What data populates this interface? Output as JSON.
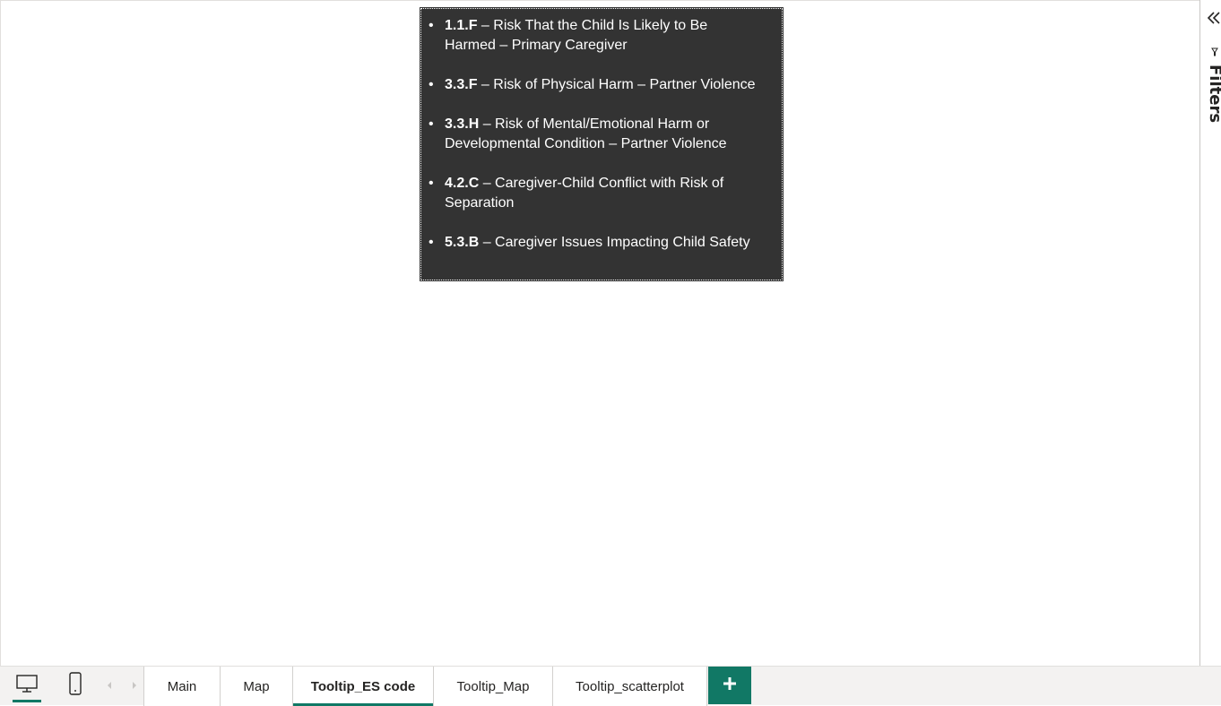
{
  "tooltip": {
    "items": [
      {
        "bullet": "•",
        "code": "1.1.F",
        "desc_line1": " – Risk That the Child Is Likely to Be",
        "desc_line2": "Harmed – Primary Caregiver"
      },
      {
        "bullet": "•",
        "code": "3.3.F",
        "desc_line1": " – Risk of Physical Harm – Partner Violence",
        "desc_line2": ""
      },
      {
        "bullet": "•",
        "code": "3.3.H",
        "desc_line1": " – Risk of Mental/Emotional Harm or",
        "desc_line2": "Developmental Condition – Partner Violence"
      },
      {
        "bullet": "•",
        "code": "4.2.C",
        "desc_line1": " – Caregiver-Child Conflict with Risk of",
        "desc_line2": "Separation"
      },
      {
        "bullet": "•",
        "code": "5.3.B",
        "desc_line1": " – Caregiver Issues Impacting Child Safety",
        "desc_line2": ""
      }
    ]
  },
  "filters_pane": {
    "label": "Filters",
    "collapse_icon": "double-chevron-left-icon",
    "filter_icon": "filter-icon"
  },
  "bottom_bar": {
    "view_buttons": {
      "desktop_icon": "desktop-icon",
      "mobile_icon": "mobile-icon"
    },
    "nav": {
      "prev_icon": "chevron-left-icon",
      "next_icon": "chevron-right-icon"
    },
    "tabs": [
      {
        "label": "Main",
        "active": false
      },
      {
        "label": "Map",
        "active": false
      },
      {
        "label": "Tooltip_ES code",
        "active": true
      },
      {
        "label": "Tooltip_Map",
        "active": false
      },
      {
        "label": "Tooltip_scatterplot",
        "active": false
      }
    ],
    "add_page_icon": "plus-icon"
  },
  "colors": {
    "accent": "#117865",
    "tooltip_bg": "#333333"
  }
}
